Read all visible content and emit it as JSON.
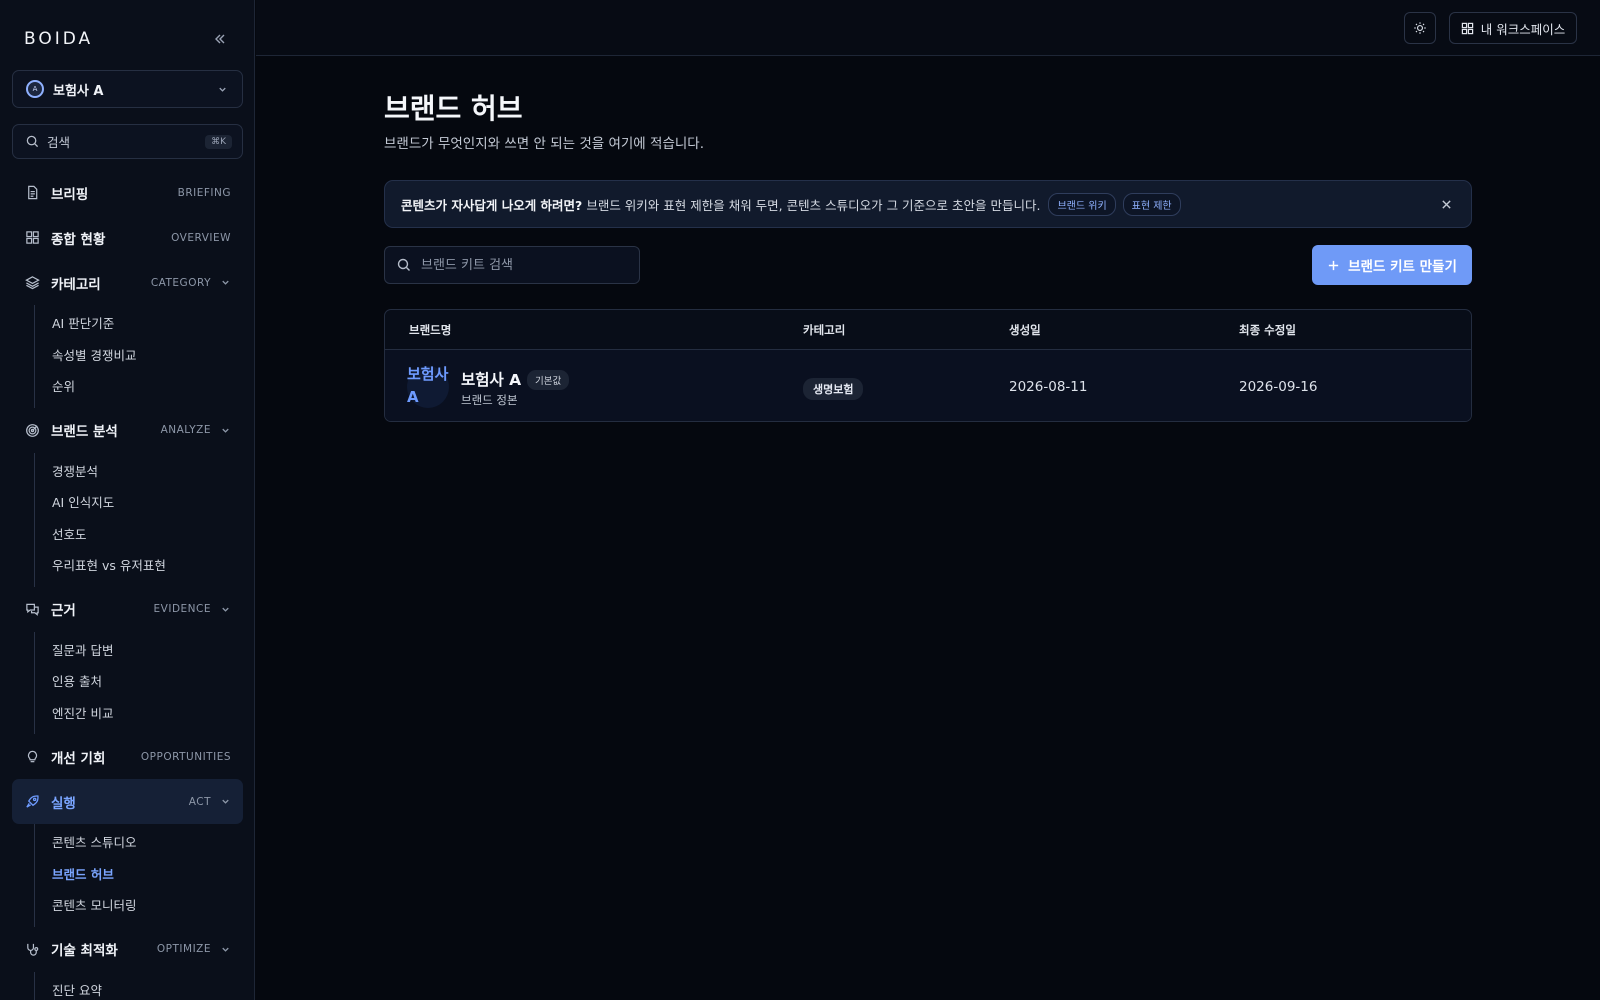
{
  "app": {
    "logo": "BOIDA"
  },
  "workspace": {
    "avatar": "A",
    "name": "보험사 A"
  },
  "search": {
    "placeholder": "검색",
    "shortcut": "⌘K"
  },
  "nav": [
    {
      "label": "브리핑",
      "code": "BRIEFING",
      "icon": "document-icon",
      "expandable": false,
      "items": []
    },
    {
      "label": "종합 현황",
      "code": "OVERVIEW",
      "icon": "grid-icon",
      "expandable": false,
      "items": []
    },
    {
      "label": "카테고리",
      "code": "CATEGORY",
      "icon": "layers-icon",
      "expandable": true,
      "items": [
        "AI 판단기준",
        "속성별 경쟁비교",
        "순위"
      ]
    },
    {
      "label": "브랜드 분석",
      "code": "ANALYZE",
      "icon": "target-icon",
      "expandable": true,
      "items": [
        "경쟁분석",
        "AI 인식지도",
        "선호도",
        "우리표현 vs 유저표현"
      ]
    },
    {
      "label": "근거",
      "code": "EVIDENCE",
      "icon": "chat-icon",
      "expandable": true,
      "items": [
        "질문과 답변",
        "인용 출처",
        "엔진간 비교"
      ]
    },
    {
      "label": "개선 기회",
      "code": "OPPORTUNITIES",
      "icon": "lightbulb-icon",
      "expandable": false,
      "items": []
    },
    {
      "label": "실행",
      "code": "ACT",
      "icon": "rocket-icon",
      "expandable": true,
      "active": true,
      "items": [
        "콘텐츠 스튜디오",
        "브랜드 허브",
        "콘텐츠 모니터링"
      ],
      "active_item": "브랜드 허브"
    },
    {
      "label": "기술 최적화",
      "code": "OPTIMIZE",
      "icon": "stethoscope-icon",
      "expandable": true,
      "items": [
        "진단 요약"
      ]
    }
  ],
  "topbar": {
    "workspace_button": "내 워크스페이스"
  },
  "page": {
    "title": "브랜드 허브",
    "subtitle": "브랜드가 무엇인지와 쓰면 안 되는 것을 여기에 적습니다."
  },
  "banner": {
    "strong": "콘텐츠가 자사답게 나오게 하려면?",
    "text": "브랜드 위키와 표현 제한을 채워 두면, 콘텐츠 스튜디오가 그 기준으로 초안을 만듭니다.",
    "chips": [
      "브랜드 위키",
      "표현 제한"
    ]
  },
  "kit_search": {
    "placeholder": "브랜드 키트 검색"
  },
  "create_button": "브랜드 키트 만들기",
  "table": {
    "headers": [
      "브랜드명",
      "카테고리",
      "생성일",
      "최종 수정일"
    ],
    "rows": [
      {
        "avatar_text": "보험사 A",
        "name": "보험사 A",
        "badge": "기본값",
        "description": "브랜드 정본",
        "category": "생명보험",
        "created": "2026-08-11",
        "modified": "2026-09-16"
      }
    ]
  },
  "colors": {
    "accent": "#6f9af7",
    "background": "#05080f",
    "sidebar": "#0a0f1a"
  }
}
